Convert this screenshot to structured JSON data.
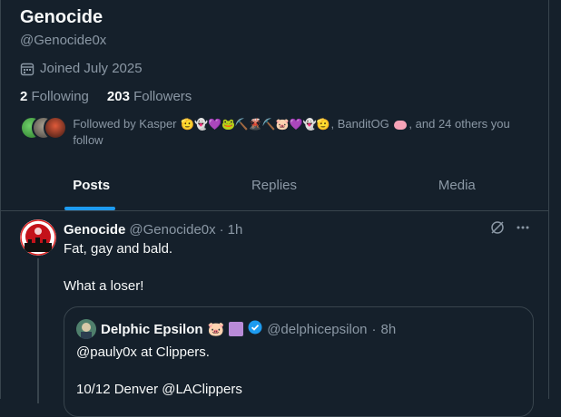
{
  "profile": {
    "name": "Genocide",
    "handle": "@Genocide0x",
    "joined": "Joined July 2025",
    "following_count": "2",
    "following_label": "Following",
    "followers_count": "203",
    "followers_label": "Followers"
  },
  "followed_by": {
    "prefix": "Followed by Kasper",
    "emojis": "🫡👻💜🐸⛏️🌋⛏️🐷💜👻🫡",
    "middle": ", BanditOG",
    "suffix": ", and 24 others you follow"
  },
  "tabs": [
    {
      "label": "Posts"
    },
    {
      "label": "Replies"
    },
    {
      "label": "Media"
    }
  ],
  "post": {
    "author": "Genocide",
    "handle": "@Genocide0x",
    "separator": "·",
    "time": "1h",
    "text_line1": "Fat, gay and bald.",
    "text_line2": "What a loser!",
    "quote": {
      "author": "Delphic Epsilon",
      "author_emoji": "🐷",
      "handle": "@delphicepsilon",
      "separator": "·",
      "time": "8h",
      "text_line1": "@pauly0x at Clippers.",
      "text_line2": "10/12 Denver @LAClippers"
    }
  },
  "icons": {
    "joined": "calendar-icon",
    "grok": "grok-icon",
    "more": "more-icon",
    "verified": "verified-badge-icon"
  },
  "colors": {
    "background": "#15202b",
    "accent": "#1d9bf0",
    "muted_text": "#8b98a5",
    "border": "#38444d"
  }
}
